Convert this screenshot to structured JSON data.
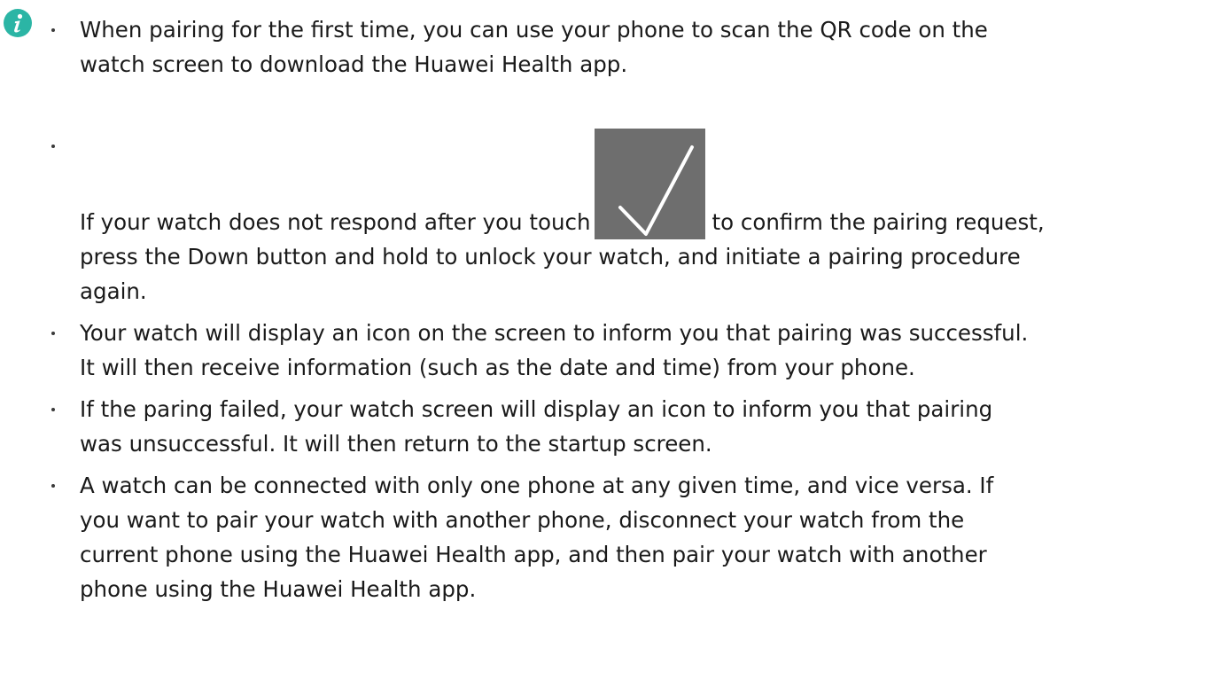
{
  "notes": {
    "icon": "info-icon",
    "accent_color": "#2bb5a5",
    "items": [
      {
        "lines": [
          "When pairing for the first time, you can use your phone to scan the QR code on the",
          "watch screen to download the Huawei Health app."
        ]
      },
      {
        "before_icon": "If your watch does not respond after you touch",
        "inline_icon": "checkmark-icon",
        "after_icon": "to confirm the pairing request,",
        "lines": [
          "press the Down button and hold to unlock your watch, and initiate a pairing procedure",
          "again."
        ]
      },
      {
        "lines": [
          "Your watch will display an icon on the screen to inform you that pairing was successful.",
          "It will then receive information (such as the date and time) from your phone."
        ]
      },
      {
        "lines": [
          "If the paring failed, your watch screen will display an icon to inform you that pairing",
          "was unsuccessful. It will then return to the startup screen."
        ]
      },
      {
        "lines": [
          "A watch can be connected with only one phone at any given time, and vice versa. If",
          "you want to pair your watch with another phone, disconnect your watch from the",
          "current phone using the Huawei Health app, and then pair your watch with another",
          "phone using the Huawei Health app."
        ]
      }
    ]
  }
}
